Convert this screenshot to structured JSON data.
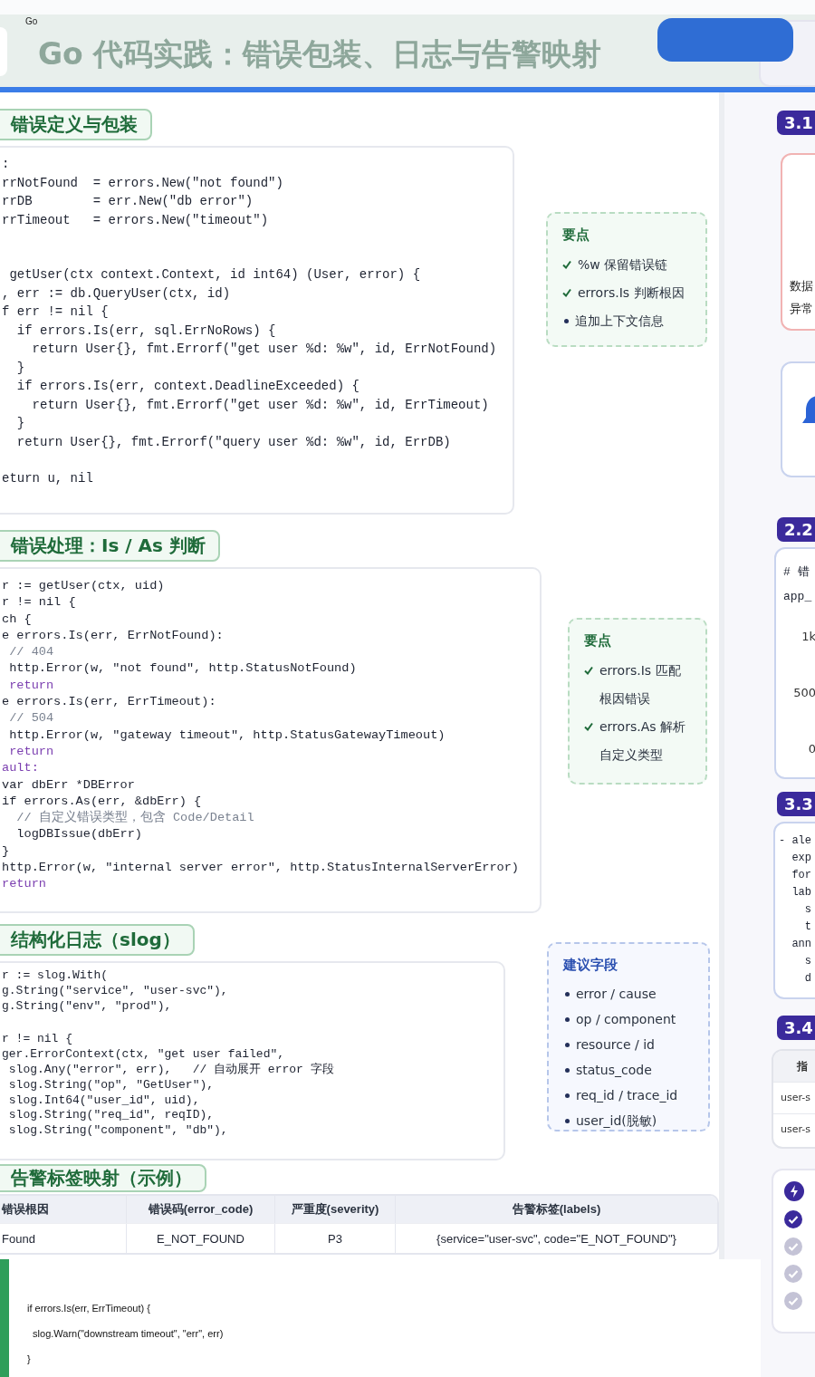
{
  "header": {
    "label": "Go",
    "title": "Go 代码实践：错误包装、日志与告警映射"
  },
  "sections": [
    {
      "title": "错误定义与包装",
      "code": [
        {
          "text": ":",
          "kind": "code"
        },
        {
          "text": "rrNotFound  = errors.New(\"not found\")",
          "kind": "code"
        },
        {
          "text": "rrDB        = err.New(\"db error\")",
          "kind": "code"
        },
        {
          "text": "rrTimeout   = errors.New(\"timeout\")",
          "kind": "code"
        },
        {
          "text": " getUser(ctx context.Context, id int64) (User, error) {",
          "kind": "code",
          "blank_before": true
        },
        {
          "text": ", err := db.QueryUser(ctx, id)",
          "kind": "code"
        },
        {
          "text": "f err != nil {",
          "kind": "code"
        },
        {
          "text": "  if errors.Is(err, sql.ErrNoRows) {",
          "kind": "code"
        },
        {
          "text": "    return User{}, fmt.Errorf(\"get user %d: %w\", id, ErrNotFound)",
          "kind": "code"
        },
        {
          "text": "  }",
          "kind": "code"
        },
        {
          "text": "  if errors.Is(err, context.DeadlineExceeded) {",
          "kind": "code"
        },
        {
          "text": "    return User{}, fmt.Errorf(\"get user %d: %w\", id, ErrTimeout)",
          "kind": "code"
        },
        {
          "text": "  }",
          "kind": "code"
        },
        {
          "text": "  return User{}, fmt.Errorf(\"query user %d: %w\", id, ErrDB)",
          "kind": "code"
        },
        {
          "text": "eturn u, nil",
          "kind": "code",
          "blank_before": true
        }
      ],
      "aside": {
        "kind": "points",
        "title": "要点",
        "items": [
          {
            "kind": "check",
            "text": "%w 保留错误链"
          },
          {
            "kind": "check",
            "text": "errors.Is 判断根因"
          },
          {
            "kind": "bullet",
            "text": "追加上下文信息"
          }
        ]
      }
    },
    {
      "title": "错误处理：Is / As 判断",
      "code": [
        {
          "text": "r := getUser(ctx, uid)",
          "kind": "code"
        },
        {
          "text": "r != nil {",
          "kind": "code"
        },
        {
          "text": "ch {",
          "kind": "code"
        },
        {
          "text": "e errors.Is(err, ErrNotFound):",
          "kind": "code"
        },
        {
          "text": " // 404",
          "kind": "comment"
        },
        {
          "text": " http.Error(w, \"not found\", http.StatusNotFound)",
          "kind": "code"
        },
        {
          "text": " return",
          "kind": "keyword"
        },
        {
          "text": "e errors.Is(err, ErrTimeout):",
          "kind": "code"
        },
        {
          "text": " // 504",
          "kind": "comment"
        },
        {
          "text": " http.Error(w, \"gateway timeout\", http.StatusGatewayTimeout)",
          "kind": "code"
        },
        {
          "text": " return",
          "kind": "keyword"
        },
        {
          "text": "ault:",
          "kind": "keyword"
        },
        {
          "text": "var dbErr *DBError",
          "kind": "code"
        },
        {
          "text": "if errors.As(err, &dbErr) {",
          "kind": "code"
        },
        {
          "text": "  // 自定义错误类型，包含 Code/Detail",
          "kind": "comment"
        },
        {
          "text": "  logDBIssue(dbErr)",
          "kind": "code"
        },
        {
          "text": "}",
          "kind": "code"
        },
        {
          "text": "http.Error(w, \"internal server error\", http.StatusInternalServerError)",
          "kind": "code"
        },
        {
          "text": "return",
          "kind": "keyword"
        }
      ],
      "aside": {
        "kind": "points",
        "title": "要点",
        "items": [
          {
            "kind": "check",
            "text": "errors.Is 匹配根因错误"
          },
          {
            "kind": "check",
            "text": "errors.As 解析自定义类型"
          }
        ]
      }
    },
    {
      "title": "结构化日志（slog）",
      "code": [
        {
          "text": "r := slog.With(",
          "kind": "code"
        },
        {
          "text": "g.String(\"service\", \"user-svc\"),",
          "kind": "code"
        },
        {
          "text": "g.String(\"env\", \"prod\"),",
          "kind": "code"
        },
        {
          "text": "r != nil {",
          "kind": "code",
          "blank_before": true
        },
        {
          "text": "ger.ErrorContext(ctx, \"get user failed\",",
          "kind": "code"
        },
        {
          "text": " slog.Any(\"error\", err),   // 自动展开 error 字段",
          "kind": "code"
        },
        {
          "text": " slog.String(\"op\", \"GetUser\"),",
          "kind": "code"
        },
        {
          "text": " slog.Int64(\"user_id\", uid),",
          "kind": "code"
        },
        {
          "text": " slog.String(\"req_id\", reqID),",
          "kind": "code"
        },
        {
          "text": " slog.String(\"component\", \"db\"),",
          "kind": "code"
        }
      ],
      "aside": {
        "kind": "fields",
        "title": "建议字段",
        "items": [
          {
            "kind": "bullet",
            "text": "error / cause"
          },
          {
            "kind": "bullet",
            "text": "op / component"
          },
          {
            "kind": "bullet",
            "text": "resource / id"
          },
          {
            "kind": "bullet",
            "text": "status_code"
          },
          {
            "kind": "bullet",
            "text": "req_id / trace_id"
          },
          {
            "kind": "bullet",
            "text": "user_id(脱敏)"
          }
        ]
      }
    }
  ],
  "alert_table": {
    "title": "告警标签映射（示例）",
    "columns": [
      "错误根因",
      "错误码(error_code)",
      "严重度(severity)",
      "告警标签(labels)"
    ],
    "rows": [
      [
        "Found",
        "E_NOT_FOUND",
        "P3",
        "{service=\"user-svc\", code=\"E_NOT_FOUND\"}"
      ]
    ]
  },
  "overlay": {
    "code": [
      "if errors.Is(err, ErrTimeout) {",
      "  slog.Warn(\"downstream timeout\", \"err\", err)",
      "}"
    ]
  },
  "right_column": {
    "blocks": [
      {
        "badge": "3.1",
        "cards": [
          {
            "kind": "text",
            "color": "#f1b3b3",
            "lines": [
              "数据",
              "异常"
            ]
          },
          {
            "kind": "icon",
            "color": "#c9d3ee"
          }
        ]
      },
      {
        "badge": "2.2",
        "cards": [
          {
            "kind": "chart",
            "color": "#c9d3ee",
            "heading": "# 错",
            "series_label": "app_",
            "ticks": [
              "1k",
              "500",
              "0"
            ]
          }
        ]
      },
      {
        "badge": "3.3",
        "cards": [
          {
            "kind": "code",
            "color": "#c9d3ee",
            "lines": [
              "- ale",
              "  exp",
              "  for",
              "  lab",
              "    s",
              "    t",
              "  ann",
              "    s",
              "    d"
            ]
          }
        ]
      },
      {
        "badge": "3.4",
        "cards": [
          {
            "kind": "table",
            "color": "#e1e3ea",
            "heading": "指",
            "rows": [
              "user-s",
              "user-s"
            ]
          }
        ]
      }
    ],
    "status_items": [
      {
        "kind": "alert"
      },
      {
        "kind": "step",
        "checked": true
      },
      {
        "kind": "step",
        "checked": false
      },
      {
        "kind": "step",
        "checked": false
      },
      {
        "kind": "step",
        "checked": false
      }
    ]
  }
}
